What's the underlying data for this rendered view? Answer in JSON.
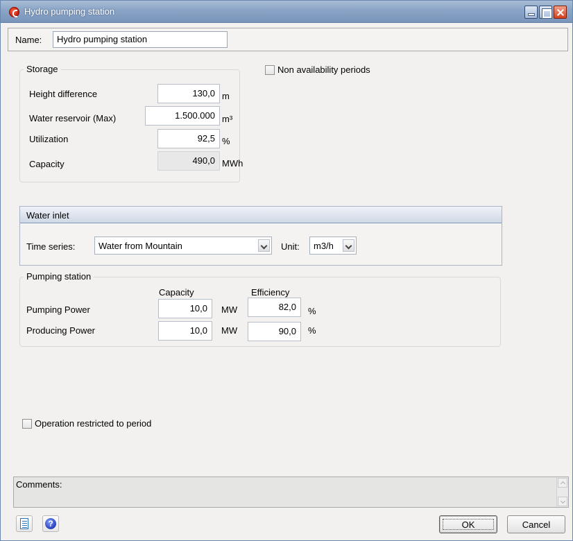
{
  "window": {
    "title": "Hydro pumping station"
  },
  "name_field": {
    "label": "Name:",
    "value": "Hydro pumping station"
  },
  "storage": {
    "title": "Storage",
    "height_difference": {
      "label": "Height difference",
      "value": "130,0",
      "unit": "m"
    },
    "water_reservoir": {
      "label": "Water reservoir (Max)",
      "value": "1.500.000",
      "unit": "m³"
    },
    "utilization": {
      "label": "Utilization",
      "value": "92,5",
      "unit": "%"
    },
    "capacity": {
      "label": "Capacity",
      "value": "490,0",
      "unit": "MWh"
    }
  },
  "non_availability": {
    "label": "Non availability periods",
    "checked": false
  },
  "water_inlet": {
    "title": "Water inlet",
    "time_series_label": "Time series:",
    "time_series_value": "Water from Mountain",
    "unit_label": "Unit:",
    "unit_value": "m3/h"
  },
  "pumping_station": {
    "title": "Pumping station",
    "col_capacity": "Capacity",
    "col_efficiency": "Efficiency",
    "pumping": {
      "label": "Pumping Power",
      "capacity": "10,0",
      "capacity_unit": "MW",
      "efficiency": "82,0",
      "efficiency_unit": "%"
    },
    "producing": {
      "label": "Producing Power",
      "capacity": "10,0",
      "capacity_unit": "MW",
      "efficiency": "90,0",
      "efficiency_unit": "%"
    }
  },
  "operation_restricted": {
    "label": "Operation restricted to period",
    "checked": false
  },
  "comments": {
    "label": "Comments:"
  },
  "buttons": {
    "ok": "OK",
    "cancel": "Cancel"
  },
  "icons": {
    "app": "app-logo-icon",
    "document": "document-icon",
    "help": "help-icon"
  }
}
